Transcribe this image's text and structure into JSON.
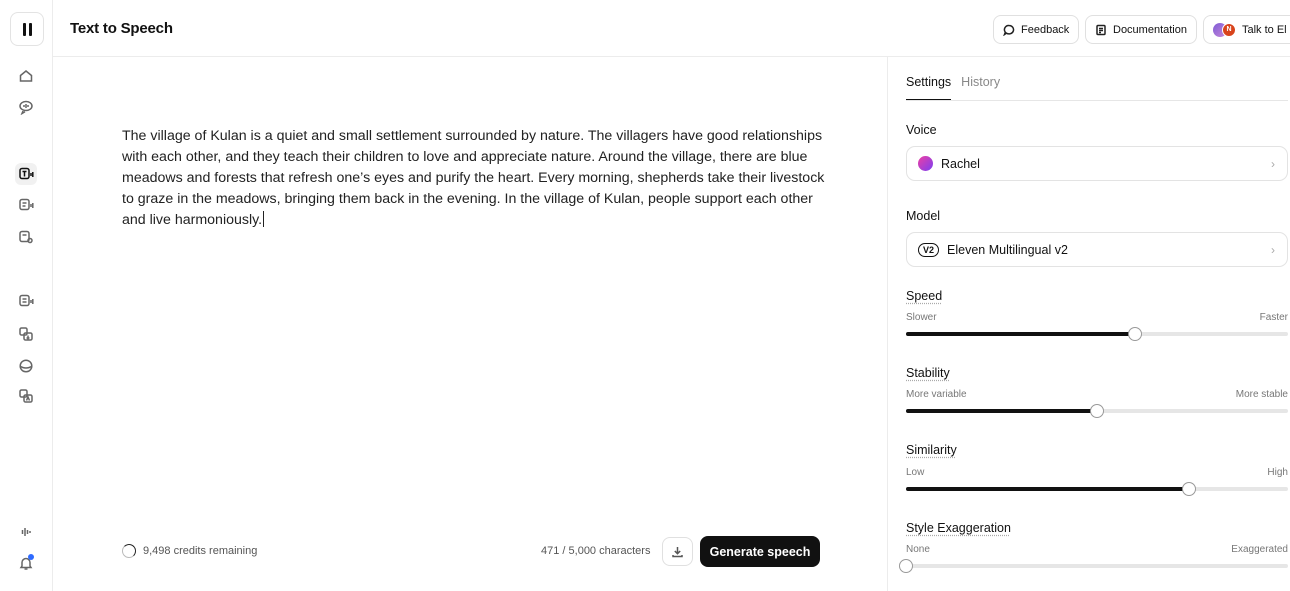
{
  "header": {
    "title": "Text to Speech",
    "buttons": {
      "feedback": "Feedback",
      "documentation": "Documentation",
      "talk": "Talk to El",
      "avatar_initial": "N"
    }
  },
  "editor": {
    "text": "The village of Kulan is a quiet and small settlement surrounded by nature. The villagers have good relationships with each other, and they teach their children to love and appreciate nature. Around the village, there are blue meadows and forests that refresh one’s eyes and purify the heart. Every morning, shepherds take their livestock to graze in the meadows, bringing them back in the evening. In the village of Kulan, people support each other and live harmoniously.",
    "credits": "9,498 credits remaining",
    "char_count": "471 / 5,000 characters",
    "generate_label": "Generate speech"
  },
  "panel": {
    "tabs": [
      "Settings",
      "History"
    ],
    "voice": {
      "label": "Voice",
      "value": "Rachel"
    },
    "model": {
      "label": "Model",
      "badge": "V2",
      "value": "Eleven Multilingual v2"
    },
    "sliders": [
      {
        "title": "Speed",
        "min_label": "Slower",
        "max_label": "Faster",
        "value": 0.6
      },
      {
        "title": "Stability",
        "min_label": "More variable",
        "max_label": "More stable",
        "value": 0.5
      },
      {
        "title": "Similarity",
        "min_label": "Low",
        "max_label": "High",
        "value": 0.74
      },
      {
        "title": "Style Exaggeration",
        "min_label": "None",
        "max_label": "Exaggerated",
        "value": 0.0
      }
    ]
  },
  "sidebar": {
    "icons": [
      "home-icon",
      "voice-chat-icon",
      "text-to-speech-icon",
      "speech-to-speech-icon",
      "voice-settings-icon",
      "dubbing-icon",
      "translate-icon",
      "voice-library-icon",
      "transcribe-icon",
      "waveform-icon",
      "notifications-icon"
    ]
  },
  "colors": {
    "accent": "#111111",
    "notification": "#2f6bff",
    "avatar": "#d8441c"
  }
}
